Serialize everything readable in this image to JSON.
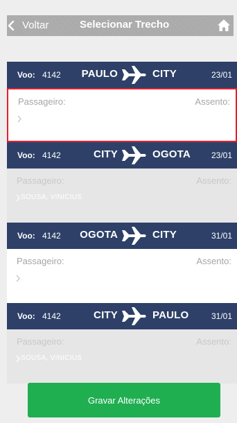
{
  "header": {
    "back_label": "Voltar",
    "title": "Selecionar Trecho",
    "home_icon": "home-icon",
    "back_icon": "chevron-left-icon"
  },
  "flights": [
    {
      "voo_label": "Voo:",
      "voo_number": "4142",
      "origin": "PAULO",
      "destination": "CITY",
      "date": "23/01",
      "passenger_label": "Passageiro:",
      "seat_label": "Assento:",
      "passenger_name": "",
      "state": "selected"
    },
    {
      "voo_label": "Voo:",
      "voo_number": "4142",
      "origin": "CITY",
      "destination": "OGOTA",
      "date": "23/01",
      "passenger_label": "Passageiro:",
      "seat_label": "Assento:",
      "passenger_name": "SOUSA, VINICIUS",
      "state": "disabled"
    },
    {
      "voo_label": "Voo:",
      "voo_number": "4142",
      "origin": "OGOTA",
      "destination": "CITY",
      "date": "31/01",
      "passenger_label": "Passageiro:",
      "seat_label": "Assento:",
      "passenger_name": "",
      "state": "normal"
    },
    {
      "voo_label": "Voo:",
      "voo_number": "4142",
      "origin": "CITY",
      "destination": "PAULO",
      "date": "31/01",
      "passenger_label": "Passageiro:",
      "seat_label": "Assento:",
      "passenger_name": "SOUSA, VINICIUS",
      "state": "disabled"
    }
  ],
  "footer": {
    "save_label": "Gravar Alterações"
  },
  "colors": {
    "header_bar": "#a9a9a9",
    "flight_header": "#2e4068",
    "selected_border": "#e41e2e",
    "save_button": "#1fae50"
  }
}
